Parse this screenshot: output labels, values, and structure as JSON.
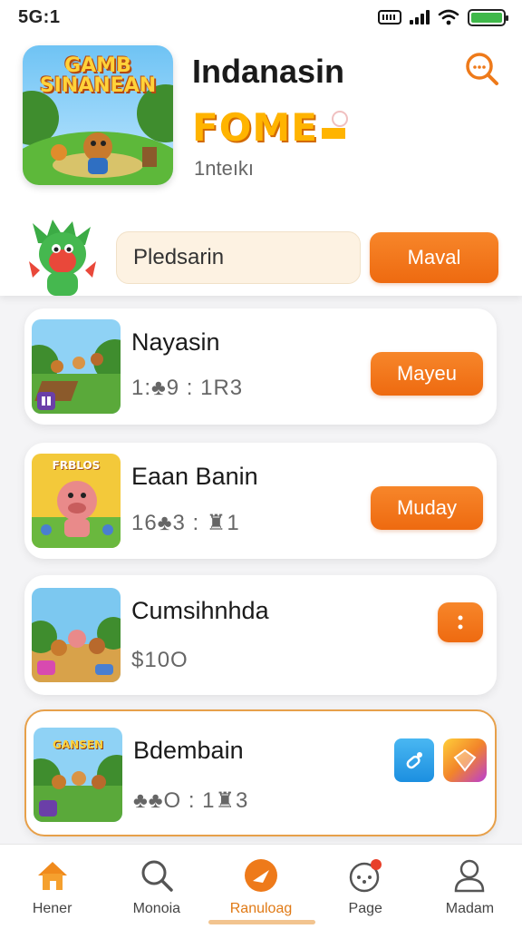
{
  "status_bar": {
    "time": "5G:1"
  },
  "hero": {
    "art_text_line1": "GAMB",
    "art_text_line2": "SINANEAN",
    "title": "Indanasin",
    "promo": "FOME",
    "subtitle": "1nteıkı"
  },
  "search": {
    "placeholder": "Pledsarin",
    "button_label": "Maval"
  },
  "cards": [
    {
      "title": "Nayasin",
      "meta": "1:♣9 : 1R3",
      "button_label": "Mayeu"
    },
    {
      "title": "Eaan Banin",
      "meta": "16♣3 : ♜1",
      "button_label": "Muday",
      "thumb_text": "FRBLOS"
    },
    {
      "title": "Cumsihnhda",
      "meta": "$10O"
    },
    {
      "title": "Bdembain",
      "meta": "♣♣O : 1♜3",
      "thumb_text": "GANSEN"
    }
  ],
  "tabs": [
    {
      "label": "Hener"
    },
    {
      "label": "Monoia"
    },
    {
      "label": "Ranuloag"
    },
    {
      "label": "Page"
    },
    {
      "label": "Madam"
    }
  ],
  "colors": {
    "accent": "#ee6a10",
    "promo": "#ffb400",
    "active_tab": "#e07a16"
  }
}
